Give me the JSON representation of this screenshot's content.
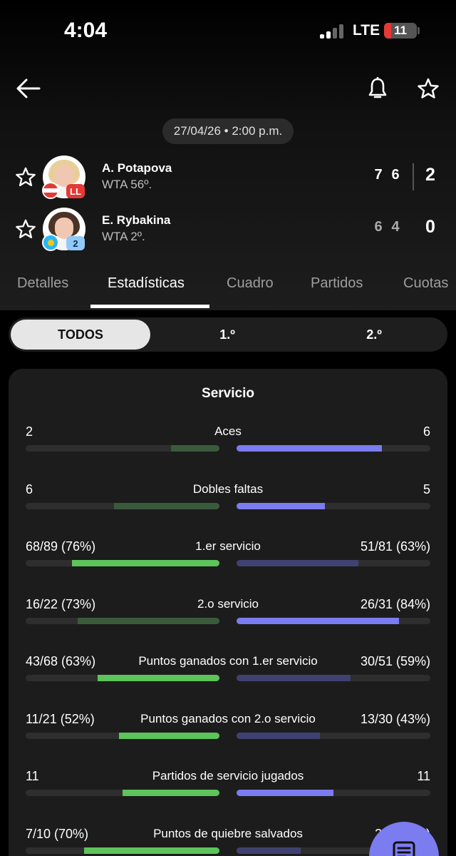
{
  "status_bar": {
    "time": "4:04",
    "network": "LTE",
    "battery": "11"
  },
  "match": {
    "datetime": "27/04/26 • 2:00 p.m.",
    "players": [
      {
        "name": "A. Potapova",
        "rank": "WTA 56º.",
        "badge": "LL",
        "flag": "austria",
        "sets": [
          "7",
          "6"
        ],
        "total": "2"
      },
      {
        "name": "E. Rybakina",
        "rank": "WTA 2º.",
        "badge": "2",
        "flag": "kazakhstan",
        "sets": [
          "6",
          "4"
        ],
        "total": "0"
      }
    ]
  },
  "tabs": [
    "Detalles",
    "Estadísticas",
    "Cuadro",
    "Partidos",
    "Cuotas"
  ],
  "active_tab": "Estadísticas",
  "segments": [
    "TODOS",
    "1.º",
    "2.º"
  ],
  "active_segment": "TODOS",
  "section": {
    "title": "Servicio",
    "stats": [
      {
        "label": "Aces",
        "left": "2",
        "right": "6",
        "left_fill": 0.25,
        "right_fill": 0.75,
        "leader": "right"
      },
      {
        "label": "Dobles faltas",
        "left": "6",
        "right": "5",
        "left_fill": 0.545,
        "right_fill": 0.455,
        "leader": "right"
      },
      {
        "label": "1.er servicio",
        "left": "68/89 (76%)",
        "right": "51/81 (63%)",
        "left_fill": 0.76,
        "right_fill": 0.63,
        "leader": "left"
      },
      {
        "label": "2.o servicio",
        "left": "16/22 (73%)",
        "right": "26/31 (84%)",
        "left_fill": 0.73,
        "right_fill": 0.84,
        "leader": "right"
      },
      {
        "label": "Puntos ganados con 1.er servicio",
        "left": "43/68 (63%)",
        "right": "30/51 (59%)",
        "left_fill": 0.63,
        "right_fill": 0.59,
        "leader": "left"
      },
      {
        "label": "Puntos ganados con 2.o servicio",
        "left": "11/21 (52%)",
        "right": "13/30 (43%)",
        "left_fill": 0.52,
        "right_fill": 0.43,
        "leader": "left"
      },
      {
        "label": "Partidos de servicio jugados",
        "left": "11",
        "right": "11",
        "left_fill": 0.5,
        "right_fill": 0.5,
        "leader": "both"
      },
      {
        "label": "Puntos de quiebre salvados",
        "left": "7/10 (70%)",
        "right": "2/6 (33%)",
        "left_fill": 0.7,
        "right_fill": 0.33,
        "leader": "left"
      }
    ]
  },
  "colors": {
    "left_leader": "#5cc45a",
    "left_trailer": "#3a5a3c",
    "right_leader": "#7b7cf0",
    "right_trailer": "#3f4270",
    "fab": "#7b7cf0"
  },
  "icons": {
    "back": "arrow-left-icon",
    "bell": "bell-icon",
    "favorite": "star-outline-icon",
    "fab": "document-lines-icon"
  }
}
